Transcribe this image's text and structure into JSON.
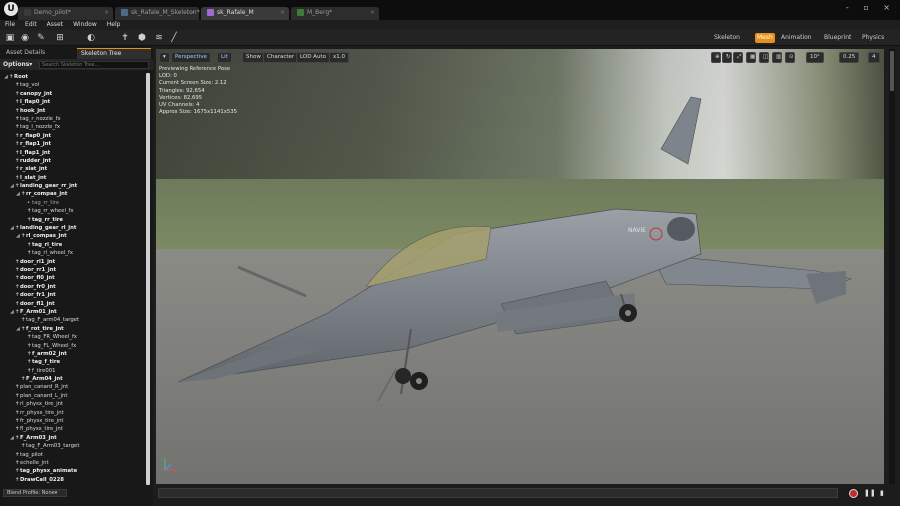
{
  "tabs": [
    {
      "label": "Demo_pilot*",
      "icon_color": "#3a3a3a"
    },
    {
      "label": "sk_Rafale_M_Skeleton*",
      "icon_color": "#4a6a8a"
    },
    {
      "label": "sk_Rafale_M",
      "icon_color": "#a36ad6"
    },
    {
      "label": "M_Berg*",
      "icon_color": "#3a7c3a"
    }
  ],
  "logo": "U",
  "window_controls": "- ▫ ×",
  "menu": [
    "File",
    "Edit",
    "Asset",
    "Window",
    "Help"
  ],
  "modes": [
    {
      "label": "Skeleton",
      "active": false
    },
    {
      "label": "Mesh",
      "active": true
    },
    {
      "label": "Animation",
      "active": false
    },
    {
      "label": "Blueprint",
      "active": false
    },
    {
      "label": "Physics",
      "active": false
    }
  ],
  "left_panel": {
    "tabs": [
      "Asset Details",
      "Skeleton Tree"
    ],
    "options_label": "Options▾",
    "search_placeholder": "Search Skeleton Tree...",
    "blend_profile": "Blend Profile: None▾",
    "tree": [
      {
        "label": "Root",
        "indent": 0,
        "bold": true,
        "expanded": true
      },
      {
        "label": "tag_vol",
        "indent": 1
      },
      {
        "label": "canopy_jnt",
        "indent": 1,
        "bold": true
      },
      {
        "label": "l_flap0_jnt",
        "indent": 1,
        "bold": true
      },
      {
        "label": "hook_jnt",
        "indent": 1,
        "bold": true
      },
      {
        "label": "tag_r_nozzle_fx",
        "indent": 1
      },
      {
        "label": "tag_l_nozzle_fx",
        "indent": 1
      },
      {
        "label": "r_flap0_jnt",
        "indent": 1,
        "bold": true
      },
      {
        "label": "r_flap1_jnt",
        "indent": 1,
        "bold": true
      },
      {
        "label": "l_flap1_jnt",
        "indent": 1,
        "bold": true
      },
      {
        "label": "rudder_jnt",
        "indent": 1,
        "bold": true
      },
      {
        "label": "r_slat_jnt",
        "indent": 1,
        "bold": true
      },
      {
        "label": "l_slat_jnt",
        "indent": 1,
        "bold": true
      },
      {
        "label": "landing_gear_rr_jnt",
        "indent": 1,
        "bold": true,
        "expanded": true
      },
      {
        "label": "rr_compas_jnt",
        "indent": 2,
        "bold": true,
        "expanded": true
      },
      {
        "label": "tag_rr_tire",
        "indent": 3,
        "dim": true
      },
      {
        "label": "tag_rr_wheel_fx",
        "indent": 3
      },
      {
        "label": "tag_rr_tire",
        "indent": 3,
        "bold": true
      },
      {
        "label": "landing_gear_rl_jnt",
        "indent": 1,
        "bold": true,
        "expanded": true
      },
      {
        "label": "rl_compas_jnt",
        "indent": 2,
        "bold": true,
        "expanded": true
      },
      {
        "label": "tag_rl_tire",
        "indent": 3,
        "bold": true
      },
      {
        "label": "tag_rl_wheel_fx",
        "indent": 3
      },
      {
        "label": "door_rl1_jnt",
        "indent": 1,
        "bold": true
      },
      {
        "label": "door_rr1_jnt",
        "indent": 1,
        "bold": true
      },
      {
        "label": "door_fl0_jnt",
        "indent": 1,
        "bold": true
      },
      {
        "label": "door_fr0_jnt",
        "indent": 1,
        "bold": true
      },
      {
        "label": "door_fr1_jnt",
        "indent": 1,
        "bold": true
      },
      {
        "label": "door_fl1_jnt",
        "indent": 1,
        "bold": true
      },
      {
        "label": "F_Arm01_jnt",
        "indent": 1,
        "bold": true,
        "expanded": true
      },
      {
        "label": "tag_F_arm04_target",
        "indent": 2
      },
      {
        "label": "f_rot_tire_jnt",
        "indent": 2,
        "bold": true,
        "expanded": true
      },
      {
        "label": "tag_FR_Wheel_fx",
        "indent": 3
      },
      {
        "label": "tag_FL_Wheel_fx",
        "indent": 3
      },
      {
        "label": "f_arm02_jnt",
        "indent": 3,
        "bold": true
      },
      {
        "label": "tag_f_tire",
        "indent": 3,
        "bold": true
      },
      {
        "label": "f_tire001",
        "indent": 3
      },
      {
        "label": "F_Arm04_jnt",
        "indent": 2,
        "bold": true
      },
      {
        "label": "plan_canard_R_jnt",
        "indent": 1
      },
      {
        "label": "plan_canard_L_jnt",
        "indent": 1
      },
      {
        "label": "rl_physx_tire_jnt",
        "indent": 1
      },
      {
        "label": "rr_physx_tire_jnt",
        "indent": 1
      },
      {
        "label": "fr_physx_tire_jnt",
        "indent": 1
      },
      {
        "label": "fl_physx_tire_jnt",
        "indent": 1
      },
      {
        "label": "F_Arm03_jnt",
        "indent": 1,
        "bold": true,
        "expanded": true
      },
      {
        "label": "tag_F_Arm03_target",
        "indent": 2
      },
      {
        "label": "tag_pilot",
        "indent": 1
      },
      {
        "label": "echelle_jnt",
        "indent": 1
      },
      {
        "label": "tag_physx_animate",
        "indent": 1,
        "bold": true
      },
      {
        "label": "DrawCall_0228",
        "indent": 1,
        "bold": true
      }
    ]
  },
  "viewport": {
    "buttons": [
      {
        "label": "▾",
        "cls": ""
      },
      {
        "label": "Perspective",
        "cls": "blue"
      },
      {
        "label": "Lit",
        "cls": "blue"
      },
      {
        "label": "Show",
        "cls": ""
      },
      {
        "label": "Character",
        "cls": ""
      },
      {
        "label": "LOD Auto",
        "cls": ""
      },
      {
        "label": "x1.0",
        "cls": ""
      }
    ],
    "right_controls": [
      "10°",
      "0.25",
      "4"
    ],
    "stats": [
      "Previewing Reference Pose",
      "LOD: 0",
      "Current Screen Size: 2.12",
      "Triangles: 92,654",
      "Vertices: 82,695",
      "UV Channels: 4",
      "Approx Size: 1675x1141x535"
    ],
    "roundel": "NAVIE"
  },
  "colors": {
    "accent": "#e8901c",
    "panel": "#181818",
    "viewport_bg": "#7a7a78"
  }
}
